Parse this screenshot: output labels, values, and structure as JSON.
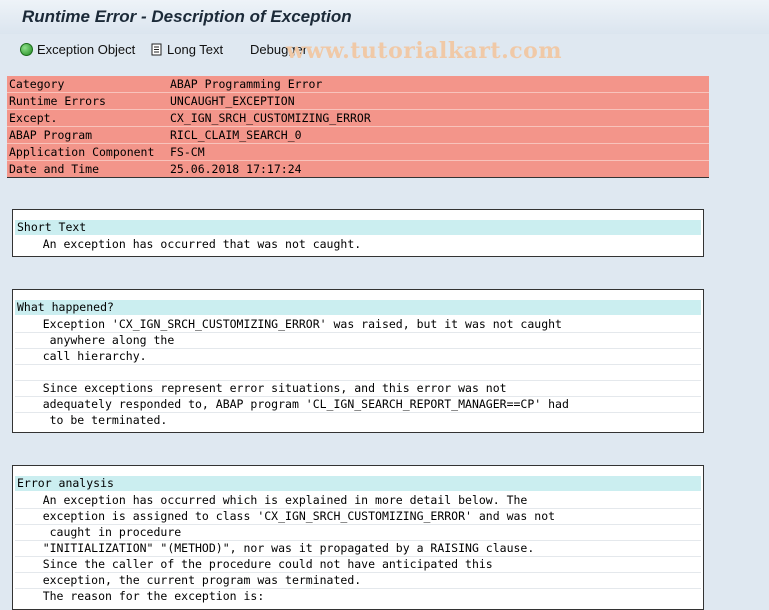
{
  "window": {
    "title": "Runtime Error - Description of Exception"
  },
  "toolbar": {
    "exception_object": "Exception Object",
    "long_text": "Long Text",
    "debugger": "Debugger"
  },
  "watermark": "www.tutorialkart.com",
  "info": [
    {
      "key": "Category",
      "value": "ABAP Programming Error"
    },
    {
      "key": "Runtime Errors",
      "value": "UNCAUGHT_EXCEPTION"
    },
    {
      "key": "Except.",
      "value": "CX_IGN_SRCH_CUSTOMIZING_ERROR"
    },
    {
      "key": "ABAP Program",
      "value": "RICL_CLAIM_SEARCH_0"
    },
    {
      "key": "Application Component",
      "value": "FS-CM"
    },
    {
      "key": "Date and Time",
      "value": "25.06.2018 17:17:24"
    }
  ],
  "short_text": {
    "heading": "Short Text",
    "lines": [
      "    An exception has occurred that was not caught."
    ]
  },
  "what_happened": {
    "heading": "What happened?",
    "lines": [
      "    Exception 'CX_IGN_SRCH_CUSTOMIZING_ERROR' was raised, but it was not caught",
      "     anywhere along the",
      "    call hierarchy.",
      "",
      "    Since exceptions represent error situations, and this error was not",
      "    adequately responded to, ABAP program 'CL_IGN_SEARCH_REPORT_MANAGER==CP' had",
      "     to be terminated."
    ]
  },
  "error_analysis": {
    "heading": "Error analysis",
    "lines": [
      "    An exception has occurred which is explained in more detail below. The",
      "    exception is assigned to class 'CX_IGN_SRCH_CUSTOMIZING_ERROR' and was not",
      "     caught in procedure",
      "    \"INITIALIZATION\" \"(METHOD)\", nor was it propagated by a RAISING clause.",
      "    Since the caller of the procedure could not have anticipated this",
      "    exception, the current program was terminated.",
      "    The reason for the exception is:"
    ]
  }
}
